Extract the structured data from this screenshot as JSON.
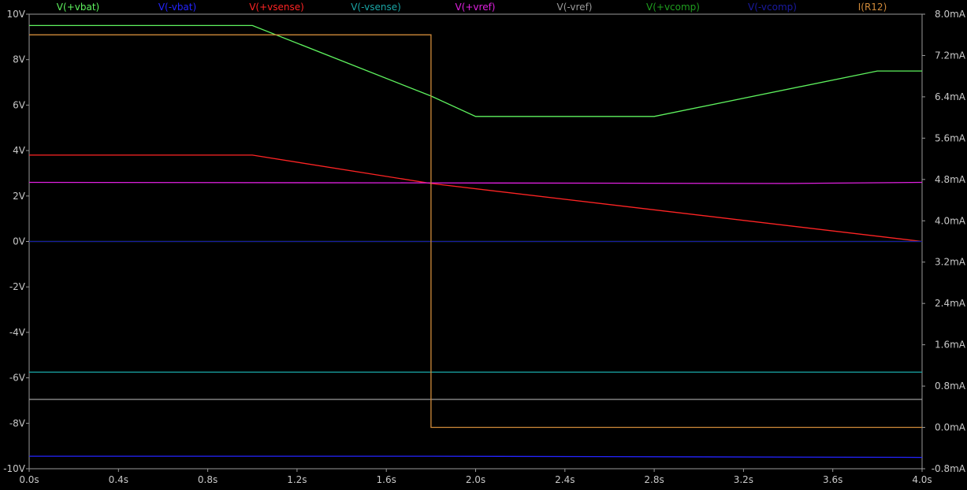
{
  "chart_data": {
    "type": "line",
    "x_axis": {
      "ticks": [
        "0.0s",
        "0.4s",
        "0.8s",
        "1.2s",
        "1.6s",
        "2.0s",
        "2.4s",
        "2.8s",
        "3.2s",
        "3.6s",
        "4.0s"
      ],
      "range": [
        0,
        4.0
      ]
    },
    "y_left": {
      "ticks": [
        "10V",
        "8V",
        "6V",
        "4V",
        "2V",
        "0V",
        "-2V",
        "-4V",
        "-6V",
        "-8V",
        "-10V"
      ],
      "range": [
        -10,
        10
      ]
    },
    "y_right": {
      "ticks": [
        "8.0mA",
        "7.2mA",
        "6.4mA",
        "5.6mA",
        "4.8mA",
        "4.0mA",
        "3.2mA",
        "2.4mA",
        "1.6mA",
        "0.8mA",
        "0.0mA",
        "-0.8mA"
      ],
      "range": [
        -0.8,
        8.0
      ]
    },
    "grid": false,
    "legend_placement": "top",
    "series": [
      {
        "name": "V(+vbat)",
        "color": "#5ef25e",
        "axis": "left",
        "x": [
          0,
          1.0,
          1.8,
          2.0,
          2.8,
          3.8,
          4.0
        ],
        "y": [
          9.5,
          9.5,
          6.4,
          5.5,
          5.5,
          7.5,
          7.5
        ]
      },
      {
        "name": "V(-vbat)",
        "color": "#2424ff",
        "axis": "left",
        "x": [
          0,
          1.8,
          4.0
        ],
        "y": [
          -9.45,
          -9.45,
          -9.5
        ]
      },
      {
        "name": "V(+vsense)",
        "color": "#ff2424",
        "axis": "left",
        "x": [
          0,
          1.0,
          1.8,
          4.0
        ],
        "y": [
          3.8,
          3.8,
          2.55,
          0.0
        ]
      },
      {
        "name": "V(-vsense)",
        "color": "#1aa6a6",
        "axis": "left",
        "x": [
          0,
          4.0
        ],
        "y": [
          -5.75,
          -5.75
        ]
      },
      {
        "name": "V(+vref)",
        "color": "#e020e0",
        "axis": "left",
        "x": [
          0,
          1.7,
          3.4,
          4.0
        ],
        "y": [
          2.6,
          2.58,
          2.55,
          2.6
        ]
      },
      {
        "name": "V(-vref)",
        "color": "#9a9a9a",
        "axis": "left",
        "x": [
          0,
          4.0
        ],
        "y": [
          -6.95,
          -6.95
        ]
      },
      {
        "name": "V(+vcomp)",
        "color": "#1f9e1f",
        "axis": "left",
        "x": [
          0,
          1.8,
          1.8,
          4.0
        ],
        "y": [
          0.0,
          0.0,
          0.0,
          0.0
        ]
      },
      {
        "name": "V(-vcomp)",
        "color": "#1a1aa0",
        "axis": "left",
        "x": [
          0,
          4.0
        ],
        "y": [
          0.0,
          0.0
        ]
      },
      {
        "name": "I(R12)",
        "color": "#d08a3a",
        "axis": "right",
        "x": [
          0,
          1.8,
          1.8,
          4.0
        ],
        "y": [
          7.6,
          7.6,
          0.0,
          0.0
        ]
      }
    ]
  }
}
